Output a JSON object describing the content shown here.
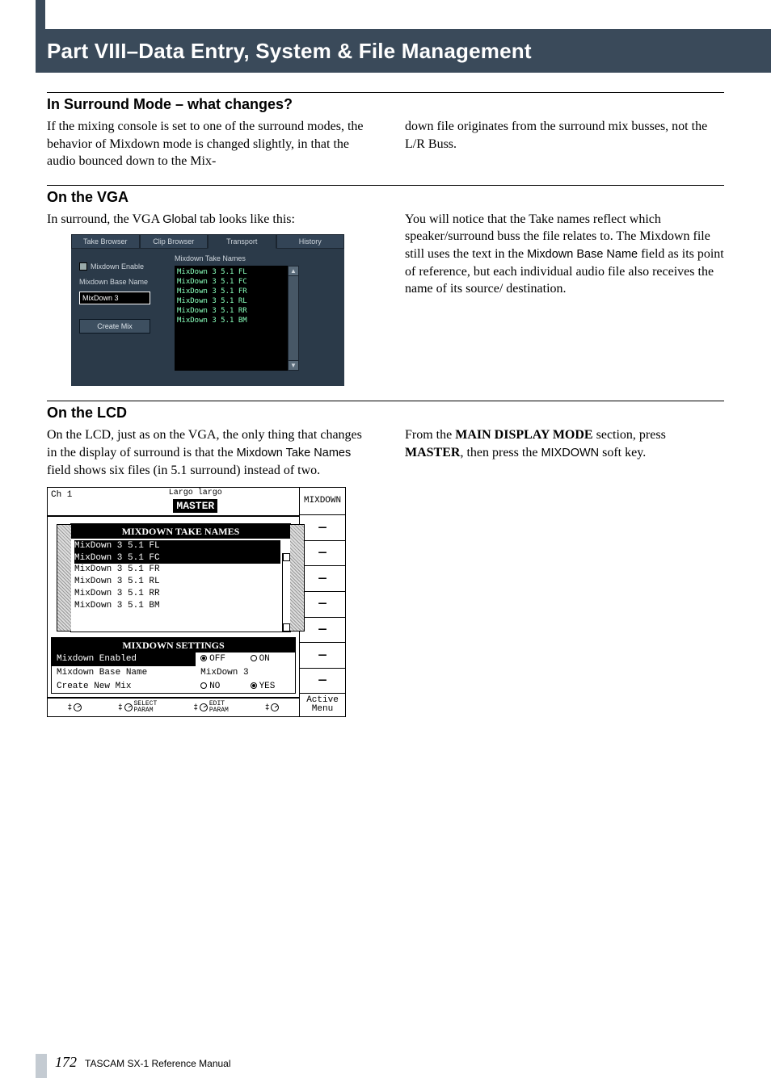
{
  "header": {
    "title": "Part VIII–Data Entry, System & File Management"
  },
  "s1": {
    "heading": "In Surround Mode – what changes?",
    "left": "If the mixing console is set to one of the surround modes, the behavior of Mixdown mode is changed slightly, in that the audio bounced down to the Mix-",
    "right": "down file originates from the surround mix busses, not the L/R Buss."
  },
  "s2": {
    "heading": "On the VGA",
    "left_pre": "In surround, the VGA ",
    "left_code": "Global",
    "left_post": " tab looks like this:",
    "right_a": "You will notice that the Take names reflect which speaker/surround buss the file relates to. The Mixdown file still uses the text in the ",
    "right_code": "Mixdown Base Name",
    "right_b": " field as its point of reference, but each individual audio file also receives the name of its source/ destination."
  },
  "vga": {
    "tabs": [
      "Take Browser",
      "Clip Browser",
      "Transport",
      "History"
    ],
    "active_tab": 2,
    "chk_label": "Mixdown Enable",
    "base_label": "Mixdown Base Name",
    "base_value": "MixDown 3",
    "create_btn": "Create Mix",
    "list_title": "Mixdown Take Names",
    "list": [
      "MixDown 3 5.1 FL",
      "MixDown 3 5.1 FC",
      "MixDown 3 5.1 FR",
      "MixDown 3 5.1 RL",
      "MixDown 3 5.1 RR",
      "MixDown 3 5.1 BM"
    ]
  },
  "s3": {
    "heading": "On the LCD",
    "left_a": "On the LCD, just as on the VGA, the only thing that changes in the display of surround is that the ",
    "left_code": "Mixdown Take Names",
    "left_b": " field shows six files (in 5.1 surround) instead of two.",
    "right_a": "From the ",
    "right_b1": "MAIN DISPLAY MODE",
    "right_c": " section, press ",
    "right_b2": "MASTER",
    "right_d": ", then press the ",
    "right_code": "MIXDOWN",
    "right_e": " soft key."
  },
  "lcd": {
    "ch": "Ch 1",
    "subtitle": "Largo largo",
    "master": "MASTER",
    "side_top": "MIXDOWN",
    "side_bottom_a": "Active",
    "side_bottom_b": "Menu",
    "panel1_title": "MIXDOWN TAKE NAMES",
    "panel1_rows": [
      "MixDown 3 5.1 FL",
      "MixDown 3 5.1 FC",
      "MixDown 3 5.1 FR",
      "MixDown 3 5.1 RL",
      "MixDown 3 5.1 RR",
      "MixDown 3 5.1 BM"
    ],
    "settings_title": "MIXDOWN SETTINGS",
    "rows": {
      "enabled": {
        "label": "Mixdown Enabled",
        "off": "OFF",
        "on": "ON"
      },
      "base": {
        "label": "Mixdown Base Name",
        "value": "MixDown 3"
      },
      "create": {
        "label": "Create New Mix",
        "no": "NO",
        "yes": "YES"
      }
    },
    "knobs": {
      "select": "SELECT\nPARAM",
      "edit": "EDIT\nPARAM"
    }
  },
  "footer": {
    "page": "172",
    "ref": "TASCAM SX-1 Reference Manual"
  }
}
